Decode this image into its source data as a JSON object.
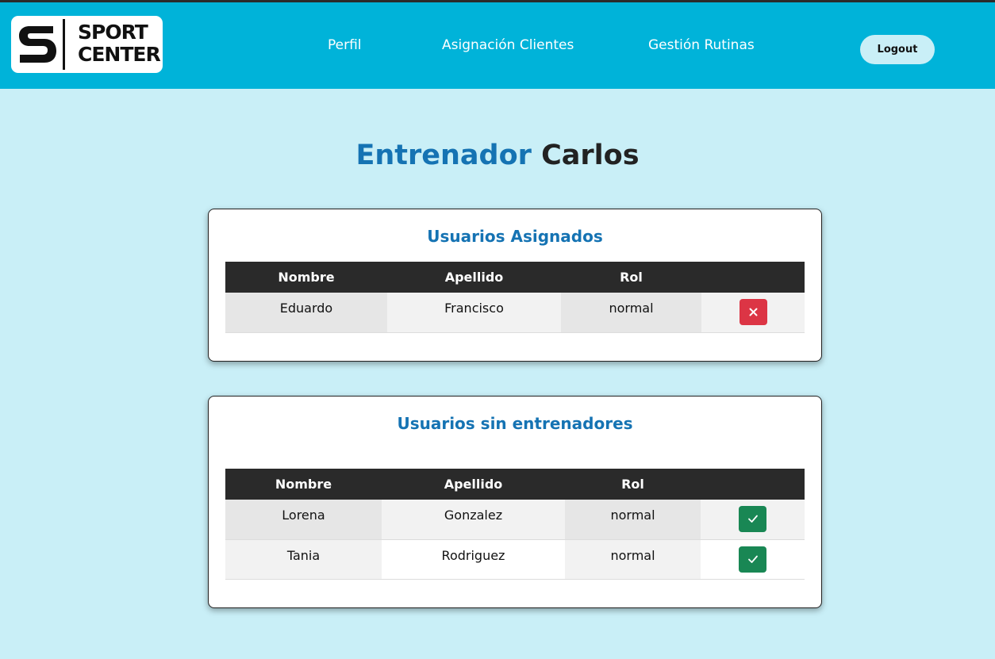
{
  "brand": {
    "line1": "SPORT",
    "line2": "CENTER",
    "icon": "s-logo-icon"
  },
  "nav": {
    "perfil": "Perfil",
    "asignacion": "Asignación Clientes",
    "gestion": "Gestión Rutinas",
    "logout": "Logout"
  },
  "page": {
    "title_role": "Entrenador",
    "title_name": "Carlos"
  },
  "assigned": {
    "title": "Usuarios Asignados",
    "headers": [
      "Nombre",
      "Apellido",
      "Rol",
      ""
    ],
    "rows": [
      {
        "nombre": "Eduardo",
        "apellido": "Francisco",
        "rol": "normal",
        "action_icon": "close-icon"
      }
    ]
  },
  "unassigned": {
    "title": "Usuarios sin entrenadores",
    "headers": [
      "Nombre",
      "Apellido",
      "Rol",
      ""
    ],
    "rows": [
      {
        "nombre": "Lorena",
        "apellido": "Gonzalez",
        "rol": "normal",
        "action_icon": "check-icon"
      },
      {
        "nombre": "Tania",
        "apellido": "Rodriguez",
        "rol": "normal",
        "action_icon": "check-icon"
      }
    ]
  },
  "colors": {
    "navbar": "#00b3d9",
    "background": "#c9eff7",
    "accent": "#1573b3",
    "danger": "#dc3545",
    "success": "#198754",
    "table_header": "#2a2a2a"
  }
}
